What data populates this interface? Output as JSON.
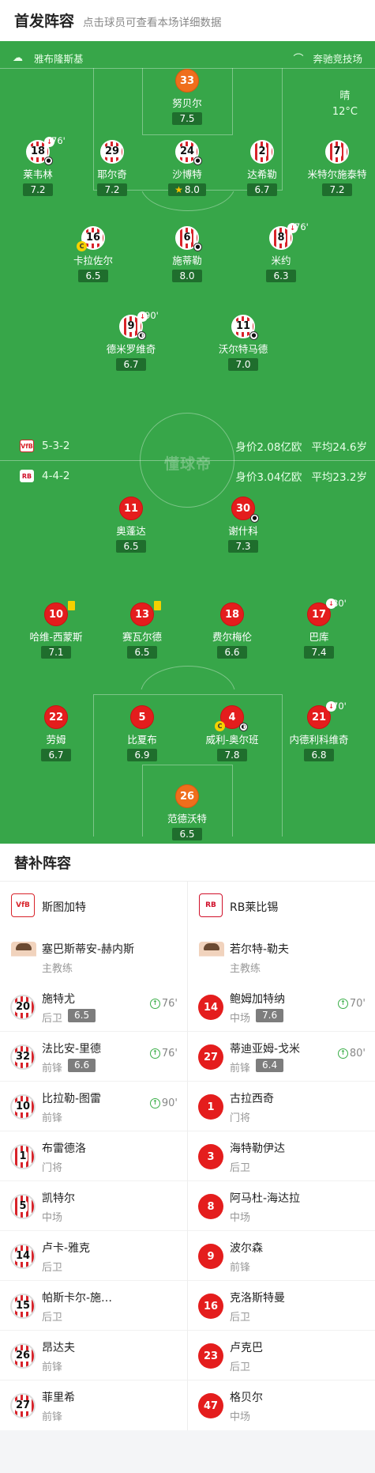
{
  "header": {
    "title": "首发阵容",
    "subtitle": "点击球员可查看本场详细数据"
  },
  "pitch": {
    "home_venue": "雅布隆斯基",
    "away_venue": "奔驰竞技场",
    "weather": "晴",
    "temperature": "12°C",
    "watermark": "懂球帝",
    "home_team": {
      "formation": "5-3-2",
      "value": "身价2.08亿欧",
      "avg_age": "平均24.6岁"
    },
    "away_team": {
      "formation": "4-4-2",
      "value": "身价3.04亿欧",
      "avg_age": "平均23.2岁"
    }
  },
  "home_players": [
    {
      "num": "33",
      "name": "努贝尔",
      "rating": "7.5"
    },
    {
      "num": "18",
      "name": "莱韦林",
      "rating": "7.2",
      "sub": "76'"
    },
    {
      "num": "29",
      "name": "耶尔奇",
      "rating": "7.2"
    },
    {
      "num": "24",
      "name": "沙博特",
      "rating": "8.0"
    },
    {
      "num": "2",
      "name": "达希勒",
      "rating": "6.7"
    },
    {
      "num": "7",
      "name": "米特尔施泰特",
      "rating": "7.2"
    },
    {
      "num": "16",
      "name": "卡拉佐尔",
      "rating": "6.5"
    },
    {
      "num": "6",
      "name": "施蒂勒",
      "rating": "8.0"
    },
    {
      "num": "8",
      "name": "米约",
      "rating": "6.3",
      "sub": "76'"
    },
    {
      "num": "9",
      "name": "德米罗维奇",
      "rating": "6.7",
      "sub": "90'"
    },
    {
      "num": "11",
      "name": "沃尔特马德",
      "rating": "7.0"
    }
  ],
  "away_players": [
    {
      "num": "11",
      "name": "奥蓬达",
      "rating": "6.5"
    },
    {
      "num": "30",
      "name": "谢什科",
      "rating": "7.3"
    },
    {
      "num": "10",
      "name": "哈维-西蒙斯",
      "rating": "7.1"
    },
    {
      "num": "13",
      "name": "赛瓦尔德",
      "rating": "6.5"
    },
    {
      "num": "18",
      "name": "费尔梅伦",
      "rating": "6.6"
    },
    {
      "num": "17",
      "name": "巴库",
      "rating": "7.4",
      "sub": "80'"
    },
    {
      "num": "22",
      "name": "劳姆",
      "rating": "6.7"
    },
    {
      "num": "5",
      "name": "比夏布",
      "rating": "6.9"
    },
    {
      "num": "4",
      "name": "威利-奥尔班",
      "rating": "7.8"
    },
    {
      "num": "21",
      "name": "内德利科维奇",
      "rating": "6.8",
      "sub": "70'"
    },
    {
      "num": "26",
      "name": "范德沃特",
      "rating": "6.5"
    }
  ],
  "bench": {
    "title": "替补阵容",
    "home_club": "斯图加特",
    "away_club": "RB莱比锡",
    "home_logo": "VfB",
    "away_logo": "RB",
    "home_coach": {
      "name": "塞巴斯蒂安-赫内斯",
      "role": "主教练"
    },
    "away_coach": {
      "name": "若尔特-勒夫",
      "role": "主教练"
    },
    "home": [
      {
        "num": "20",
        "name": "施特尤",
        "pos": "后卫",
        "rating": "6.5",
        "sub": "76'"
      },
      {
        "num": "32",
        "name": "法比安-里德",
        "pos": "前锋",
        "rating": "6.6",
        "sub": "76'"
      },
      {
        "num": "10",
        "name": "比拉勒-图雷",
        "pos": "前锋",
        "sub": "90'"
      },
      {
        "num": "1",
        "name": "布雷德洛",
        "pos": "门将"
      },
      {
        "num": "5",
        "name": "凯特尔",
        "pos": "中场"
      },
      {
        "num": "14",
        "name": "卢卡-雅克",
        "pos": "后卫"
      },
      {
        "num": "15",
        "name": "帕斯卡尔-施…",
        "pos": "后卫"
      },
      {
        "num": "26",
        "name": "昂达夫",
        "pos": "前锋"
      },
      {
        "num": "27",
        "name": "菲里希",
        "pos": "前锋"
      }
    ],
    "away": [
      {
        "num": "14",
        "name": "鲍姆加特纳",
        "pos": "中场",
        "rating": "7.6",
        "sub": "70'"
      },
      {
        "num": "27",
        "name": "蒂迪亚姆-戈米",
        "pos": "前锋",
        "rating": "6.4",
        "sub": "80'"
      },
      {
        "num": "1",
        "name": "古拉西奇",
        "pos": "门将"
      },
      {
        "num": "3",
        "name": "海特勒伊达",
        "pos": "后卫"
      },
      {
        "num": "8",
        "name": "阿马杜-海达拉",
        "pos": "中场"
      },
      {
        "num": "9",
        "name": "波尔森",
        "pos": "前锋"
      },
      {
        "num": "16",
        "name": "克洛斯特曼",
        "pos": "后卫"
      },
      {
        "num": "23",
        "name": "卢克巴",
        "pos": "后卫"
      },
      {
        "num": "47",
        "name": "格贝尔",
        "pos": "中场"
      }
    ]
  }
}
